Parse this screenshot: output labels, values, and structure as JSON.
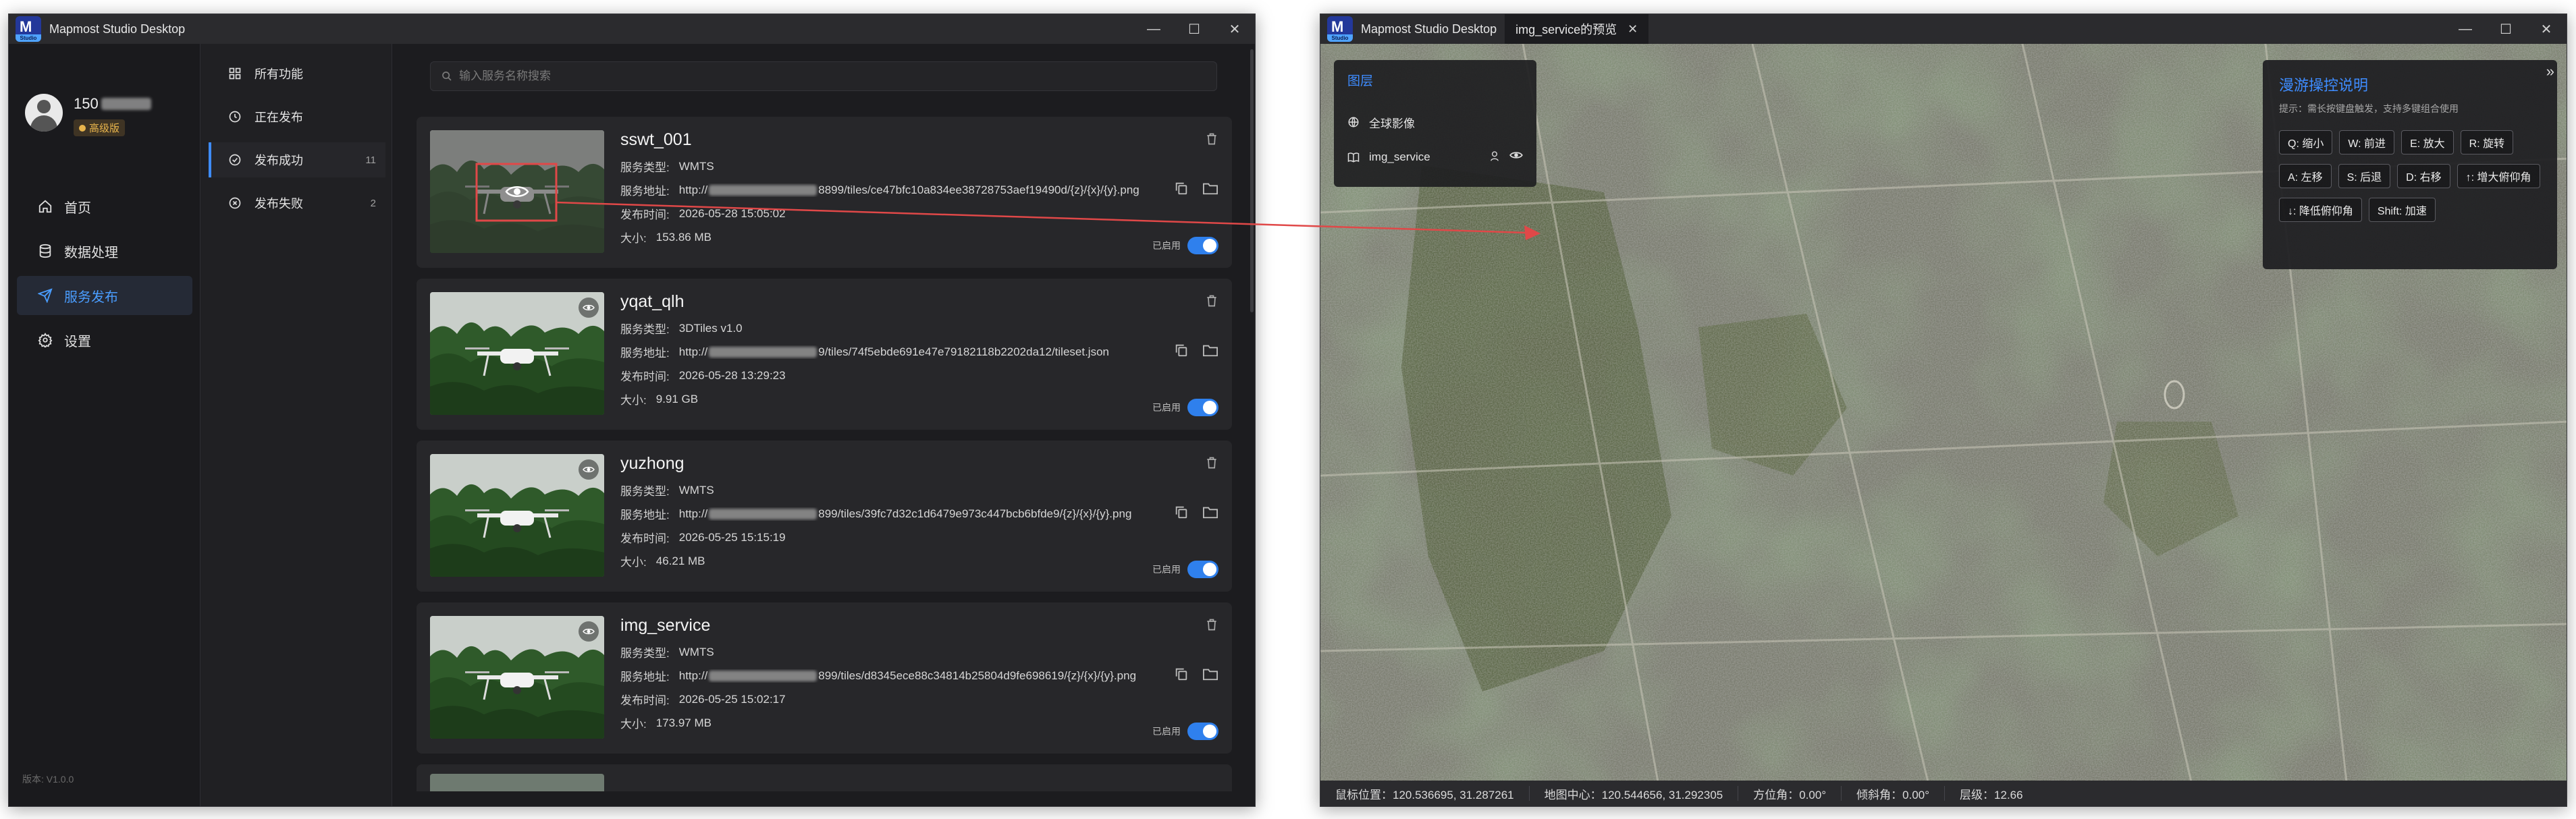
{
  "left_window": {
    "title": "Mapmost Studio Desktop",
    "logo_text": "M",
    "logo_sub": "Studio",
    "controls": [
      "—",
      "☐",
      "✕"
    ],
    "user": {
      "id_visible": "150",
      "badge": "高级版"
    },
    "nav": [
      {
        "label": "首页",
        "icon": "home-icon"
      },
      {
        "label": "数据处理",
        "icon": "database-icon"
      },
      {
        "label": "服务发布",
        "icon": "send-icon",
        "active": true
      },
      {
        "label": "设置",
        "icon": "gear-icon"
      }
    ],
    "version": "版本: V1.0.0",
    "subnav": [
      {
        "label": "所有功能",
        "count": ""
      },
      {
        "label": "正在发布",
        "count": ""
      },
      {
        "label": "发布成功",
        "count": "11",
        "active": true
      },
      {
        "label": "发布失败",
        "count": "2"
      }
    ],
    "search": {
      "placeholder": "输入服务名称搜索",
      "value": ""
    },
    "field_labels": {
      "type": "服务类型:",
      "url": "服务地址:",
      "time": "发布时间:",
      "size": "大小:",
      "enabled": "已启用"
    },
    "cards": [
      {
        "name": "sswt_001",
        "type": "WMTS",
        "url_prefix": "http://",
        "url_tail": "8899/tiles/ce47bfc10a834ee38728753aef19490d/{z}/{x}/{y}.png",
        "time": "2026-05-28 15:05:02",
        "size": "153.86 MB",
        "enabled": true
      },
      {
        "name": "yqat_qlh",
        "type": "3DTiles v1.0",
        "url_prefix": "http://",
        "url_tail": "9/tiles/74f5ebde691e47e79182118b2202da12/tileset.json",
        "time": "2026-05-28 13:29:23",
        "size": "9.91 GB",
        "enabled": true
      },
      {
        "name": "yuzhong",
        "type": "WMTS",
        "url_prefix": "http://",
        "url_tail": "899/tiles/39fc7d32c1d6479e973c447bcb6bfde9/{z}/{x}/{y}.png",
        "time": "2026-05-25 15:15:19",
        "size": "46.21 MB",
        "enabled": true
      },
      {
        "name": "img_service",
        "type": "WMTS",
        "url_prefix": "http://",
        "url_tail": "899/tiles/d8345ece88c34814b25804d9fe698619/{z}/{x}/{y}.png",
        "time": "2026-05-25 15:02:17",
        "size": "173.97 MB",
        "enabled": true
      }
    ]
  },
  "right_window": {
    "title": "Mapmost Studio Desktop",
    "tab_label": "img_service的预览",
    "layers": {
      "title": "图层",
      "items": [
        {
          "label": "全球影像",
          "icon": "globe-icon"
        },
        {
          "label": "img_service",
          "icon": "book-icon"
        }
      ]
    },
    "help": {
      "title": "漫游操控说明",
      "tip": "提示：需长按键盘触发，支持多键组合使用",
      "keys": [
        "Q: 缩小",
        "W: 前进",
        "E: 放大",
        "R: 旋转",
        "A: 左移",
        "S: 后退",
        "D: 右移",
        "↑: 增大俯仰角",
        "↓: 降低俯仰角",
        "Shift: 加速"
      ]
    },
    "status": {
      "cursor": "鼠标位置：120.536695, 31.287261",
      "center": "地图中心：120.544656, 31.292305",
      "bearing": "方位角：0.00°",
      "pitch": "倾斜角：0.00°",
      "level": "层级：12.66"
    }
  },
  "colors": {
    "accent": "#3e8cff",
    "toggle_on": "#2f80ed",
    "badge": "#e8b44c",
    "highlight": "#e04848"
  }
}
